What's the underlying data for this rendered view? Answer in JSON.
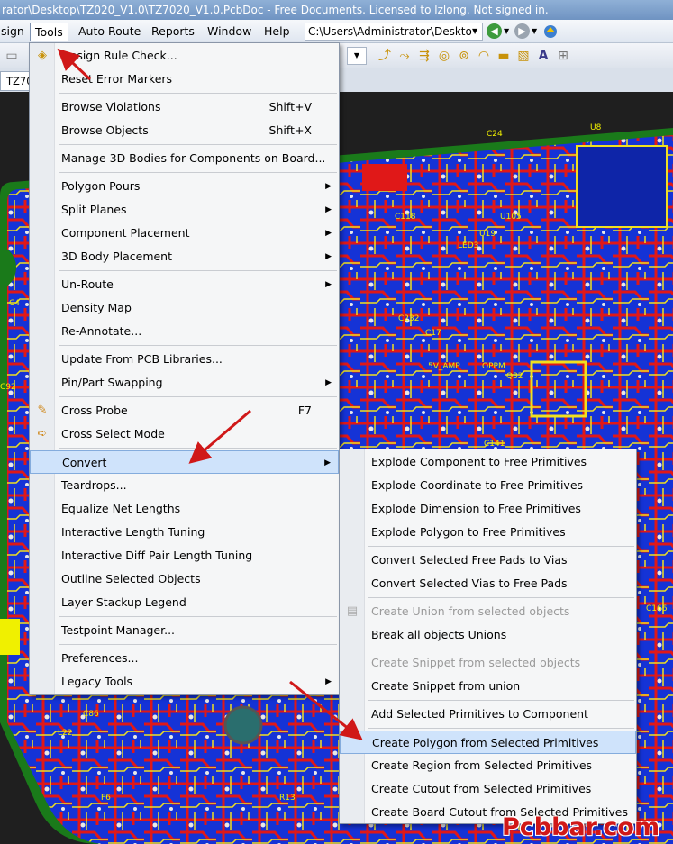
{
  "window": {
    "title": "rator\\Desktop\\TZ020_V1.0\\TZ7020_V1.0.PcbDoc - Free Documents. Licensed to lzlong. Not signed in."
  },
  "menubar": {
    "items": [
      "sign",
      "Tools",
      "Auto Route",
      "Reports",
      "Window",
      "Help"
    ],
    "path": "C:\\Users\\Administrator\\Deskto"
  },
  "tab": {
    "label": "TZ70"
  },
  "tools_menu": {
    "items": [
      {
        "label": "Design Rule Check...",
        "shortcut": "",
        "submenu": false,
        "icon": "drc-icon"
      },
      {
        "label": "Reset Error Markers",
        "shortcut": "",
        "submenu": false
      },
      {
        "label": "Browse Violations",
        "shortcut": "Shift+V",
        "submenu": false
      },
      {
        "label": "Browse Objects",
        "shortcut": "Shift+X",
        "submenu": false
      },
      {
        "label": "Manage 3D Bodies for Components on Board...",
        "shortcut": "",
        "submenu": false
      },
      {
        "label": "Polygon Pours",
        "shortcut": "",
        "submenu": true
      },
      {
        "label": "Split Planes",
        "shortcut": "",
        "submenu": true
      },
      {
        "label": "Component Placement",
        "shortcut": "",
        "submenu": true
      },
      {
        "label": "3D Body Placement",
        "shortcut": "",
        "submenu": true
      },
      {
        "label": "Un-Route",
        "shortcut": "",
        "submenu": true
      },
      {
        "label": "Density Map",
        "shortcut": "",
        "submenu": false
      },
      {
        "label": "Re-Annotate...",
        "shortcut": "",
        "submenu": false
      },
      {
        "label": "Update From PCB Libraries...",
        "shortcut": "",
        "submenu": false
      },
      {
        "label": "Pin/Part Swapping",
        "shortcut": "",
        "submenu": true
      },
      {
        "label": "Cross Probe",
        "shortcut": "F7",
        "submenu": false,
        "icon": "cross-probe-icon"
      },
      {
        "label": "Cross Select Mode",
        "shortcut": "",
        "submenu": false,
        "icon": "cross-select-icon"
      },
      {
        "label": "Convert",
        "shortcut": "",
        "submenu": true,
        "highlighted": true
      },
      {
        "label": "Teardrops...",
        "shortcut": "",
        "submenu": false
      },
      {
        "label": "Equalize Net Lengths",
        "shortcut": "",
        "submenu": false
      },
      {
        "label": "Interactive Length Tuning",
        "shortcut": "",
        "submenu": false
      },
      {
        "label": "Interactive Diff Pair Length Tuning",
        "shortcut": "",
        "submenu": false
      },
      {
        "label": "Outline Selected Objects",
        "shortcut": "",
        "submenu": false
      },
      {
        "label": "Layer Stackup Legend",
        "shortcut": "",
        "submenu": false
      },
      {
        "label": "Testpoint Manager...",
        "shortcut": "",
        "submenu": false
      },
      {
        "label": "Preferences...",
        "shortcut": "",
        "submenu": false
      },
      {
        "label": "Legacy Tools",
        "shortcut": "",
        "submenu": true
      }
    ]
  },
  "convert_menu": {
    "items": [
      {
        "label": "Explode Component to Free Primitives",
        "disabled": false
      },
      {
        "label": "Explode Coordinate to Free Primitives",
        "disabled": false
      },
      {
        "label": "Explode Dimension to Free Primitives",
        "disabled": false
      },
      {
        "label": "Explode Polygon to Free Primitives",
        "disabled": false
      },
      {
        "label": "Convert Selected Free Pads to Vias",
        "disabled": false
      },
      {
        "label": "Convert Selected Vias to Free Pads",
        "disabled": false
      },
      {
        "label": "Create Union from selected objects",
        "disabled": true
      },
      {
        "label": "Break all objects Unions",
        "disabled": false
      },
      {
        "label": "Create Snippet from selected objects",
        "disabled": true
      },
      {
        "label": "Create Snippet from union",
        "disabled": false
      },
      {
        "label": "Add Selected Primitives to Component",
        "disabled": false
      },
      {
        "label": "Create Polygon from Selected Primitives",
        "disabled": false,
        "highlighted": true
      },
      {
        "label": "Create Region from Selected Primitives",
        "disabled": false
      },
      {
        "label": "Create Cutout from Selected Primitives",
        "disabled": false
      },
      {
        "label": "Create Board Cutout from Selected Primitives",
        "disabled": false
      }
    ]
  },
  "pcb": {
    "labels": [
      "C24",
      "U8",
      "C118",
      "U105",
      "U19",
      "LED3",
      "C232",
      "C17",
      "R46",
      "C106",
      "OPPM",
      "Q32",
      "5V_AMP",
      "C141",
      "C92",
      "C4",
      "L22",
      "F6",
      "C86",
      "R13",
      "U58",
      "C166"
    ]
  },
  "watermark": "Pcbbar.com"
}
